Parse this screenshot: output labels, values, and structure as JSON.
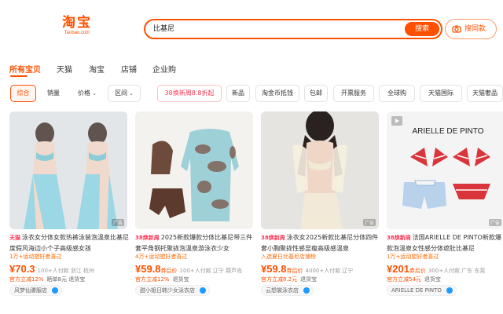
{
  "header": {
    "logo_text": "淘宝",
    "logo_sub": "Taobao.com",
    "search_value": "比基尼",
    "search_button": "搜索",
    "photo_search": "搜同款"
  },
  "tabs": [
    "所有宝贝",
    "天猫",
    "淘宝",
    "店铺",
    "企业购"
  ],
  "filters": {
    "sort_default": "综合",
    "sales": "销量",
    "price": "价格",
    "range": "区间",
    "promo": "38焕新周8.8折起",
    "tags": [
      "新品",
      "淘金币抵钱",
      "包邮",
      "开票服务",
      "全球购",
      "天猫国际",
      "天猫奢品"
    ]
  },
  "products": [
    {
      "badge": "天猫",
      "title": "泳衣女分体女款热裤泳装泡温泉比基尼度假风海边小个子高级感女孩",
      "sub": "1万+运动塑好者喜过",
      "price": "¥70.3",
      "price_suffix": "",
      "sold": "100+人付款",
      "location": "浙江 杭州",
      "extra": "官方立减12%",
      "extra_gray": "晒单8元 退货宝",
      "shop": "风梦仙骡服店",
      "ad": "广告",
      "image_bg": "#dfe4e6",
      "image_accent": "#7ec8d8"
    },
    {
      "badge": "38焕新周",
      "title": "2025新款爆款分体比基尼带三件套平角钢托聚拢泡温泉游泳衣少女",
      "sub": "4万+运动塑好者喜过",
      "price": "¥59.8",
      "price_suffix": "券后价",
      "sold": "100+人付款",
      "location": "辽宁 葫芦岛",
      "extra": "官方立减12%",
      "extra_gray": "退货宝",
      "shop": "甜小姐日韩少女泳衣店",
      "ad": "",
      "image_bg": "#f4f2ef",
      "image_accent": "#6e4a3a"
    },
    {
      "badge": "38焕新周",
      "title": "泳衣女2025新款比基尼分体四件套小胸聚拢性感显瘦高级感温泉",
      "sub": "入选夏日比基尼店铺榜",
      "price": "¥59.8",
      "price_suffix": "券后价",
      "sold": "4000+人付款",
      "location": "辽宁",
      "extra": "官方立减8.2元",
      "extra_gray": "退货宝",
      "shop": "云想裳泳衣店",
      "ad": "广告",
      "image_bg": "#e8e6e3",
      "image_accent": "#f1ead7"
    },
    {
      "badge": "38焕新周",
      "title": "法国ARIELLE DE PINTO新款爆款泡温泉女性感分体遮肚比基尼",
      "sub": "1万+运动塑好者喜过",
      "price": "¥201",
      "price_suffix": "券后价",
      "sold": "300+人付款",
      "location": "广东 东莞",
      "extra": "官方立减54元",
      "extra_gray": "退货宝",
      "shop": "ARIELLE DE PINTO",
      "ad": "广告",
      "brand_text": "ARIELLE DE PINTO",
      "image_bg": "#f4f4f4",
      "image_accent": "#d9353b"
    }
  ]
}
